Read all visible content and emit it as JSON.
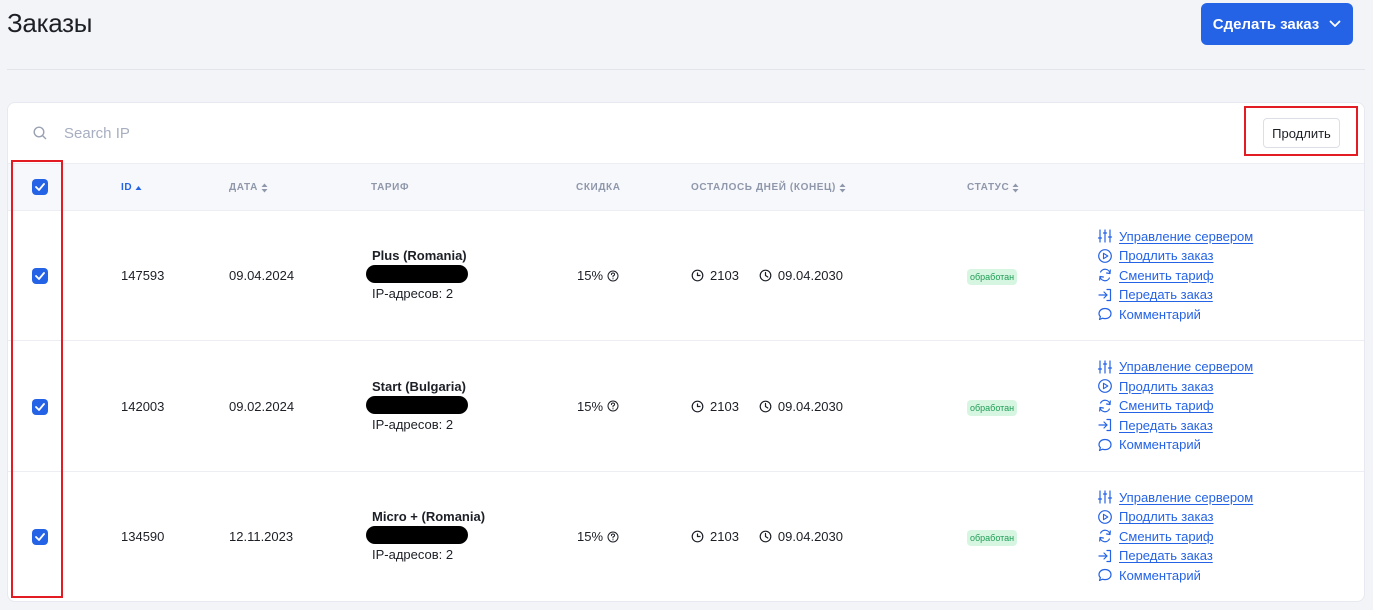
{
  "page": {
    "title": "Заказы"
  },
  "header": {
    "make_order_label": "Сделать заказ"
  },
  "search": {
    "placeholder": "Search IP"
  },
  "toolbar": {
    "extend_label": "Продлить"
  },
  "table": {
    "columns": {
      "id": "ID",
      "date": "ДАТА",
      "tariff": "ТАРИФ",
      "discount": "СКИДКА",
      "days_left": "ОСТАЛОСЬ ДНЕЙ (КОНЕЦ)",
      "status": "СТАТУС"
    },
    "rows": [
      {
        "id": "147593",
        "date": "09.04.2024",
        "tariff_name": "Plus (Romania)",
        "ip_count": "IP-адресов: 2",
        "discount": "15%",
        "days": "2103",
        "end_date": "09.04.2030",
        "status": "обработан",
        "checked": true
      },
      {
        "id": "142003",
        "date": "09.02.2024",
        "tariff_name": "Start (Bulgaria)",
        "ip_count": "IP-адресов: 2",
        "discount": "15%",
        "days": "2103",
        "end_date": "09.04.2030",
        "status": "обработан",
        "checked": true
      },
      {
        "id": "134590",
        "date": "12.11.2023",
        "tariff_name": "Micro + (Romania)",
        "ip_count": "IP-адресов: 2",
        "discount": "15%",
        "days": "2103",
        "end_date": "09.04.2030",
        "status": "обработан",
        "checked": true
      }
    ],
    "actions": {
      "manage_server": "Управление сервером",
      "extend_order": "Продлить заказ",
      "change_tariff": "Сменить тариф",
      "transfer_order": "Передать заказ",
      "comment": "Комментарий"
    }
  },
  "colors": {
    "accent": "#2563e6",
    "status_text": "#1f9d55",
    "status_bg": "#d7f6e2",
    "highlight": "#e31b23"
  },
  "icons": {
    "search": "search-icon",
    "chevron": "chevron-down-icon",
    "manage": "sliders-icon",
    "extend": "play-circle-icon",
    "change": "refresh-icon",
    "transfer": "sign-in-icon",
    "comment": "chat-bubble-icon",
    "clock_half": "clock-half-icon",
    "clock": "clock-icon",
    "help": "question-circle-icon"
  }
}
